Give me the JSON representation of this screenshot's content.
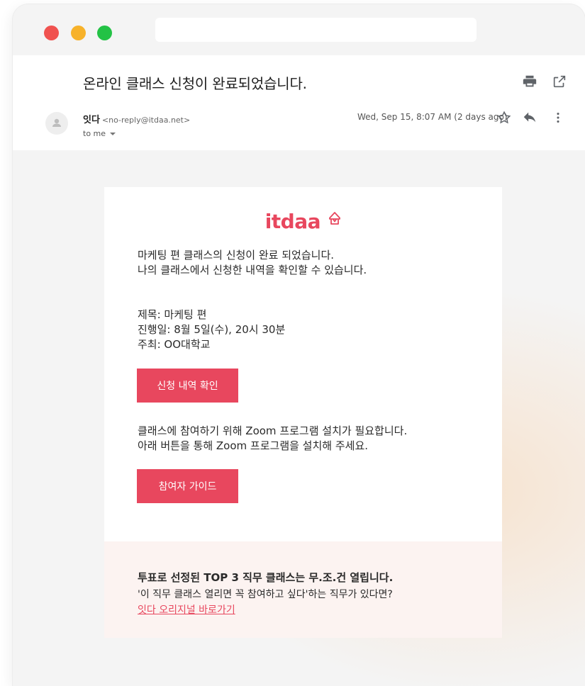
{
  "email": {
    "subject": "온라인 클래스 신청이 완료되었습니다.",
    "sender_name": "잇다",
    "sender_email": "<no-reply@itdaa.net>",
    "recipient": "to me",
    "date": "Wed, Sep 15, 8:07 AM (2 days ago)"
  },
  "icons": [
    "print-icon",
    "open-in-new-icon",
    "avatar-icon",
    "star-icon",
    "reply-icon",
    "more-vert-icon",
    "itdaa-logo-icon"
  ],
  "content": {
    "logo_text": "itdaa",
    "intro_lines": [
      "마케팅 편 클래스의 신청이 완료 되었습니다.",
      "나의 클래스에서 신청한 내역을 확인할 수 있습니다."
    ],
    "details": [
      "제목: 마케팅 편",
      "진행일: 8월 5일(수), 20시 30분",
      "주최: OO대학교"
    ],
    "confirm_button": "신청 내역 확인",
    "zoom_lines": [
      "클래스에 참여하기 위해 Zoom 프로그램 설치가 필요합니다.",
      "아래 버튼을 통해 Zoom 프로그램을 설치해 주세요."
    ],
    "guide_button": "참여자 가이드",
    "promo": {
      "headline": "투표로 선정된 TOP 3 직무 클래스는 무.조.건 열립니다.",
      "text": "'이 직무 클래스 열리면 꼭 참여하고 싶다'하는 직무가 있다면?",
      "link": "잇다 오리지널 바로가기"
    }
  },
  "colors": {
    "accent": "#e8475e",
    "promo_bg": "#fcf3f1",
    "window_bg": "#f4f4f4",
    "traffic_red": "#f0524f",
    "traffic_yellow": "#f7b22a",
    "traffic_green": "#23c245"
  }
}
